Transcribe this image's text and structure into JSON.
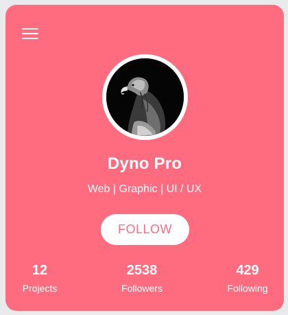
{
  "profile": {
    "name": "Dyno Pro",
    "subtitle": "Web | Graphic | UI / UX",
    "avatar_icon": "eagle-photo"
  },
  "menu": {
    "icon": "hamburger-menu-icon"
  },
  "actions": {
    "follow_label": "FOLLOW"
  },
  "stats": [
    {
      "value": "12",
      "label": "Projects"
    },
    {
      "value": "2538",
      "label": "Followers"
    },
    {
      "value": "429",
      "label": "Following"
    }
  ],
  "colors": {
    "card_background": "#ff6b7f",
    "page_background": "#e9eaec",
    "text": "#ffffff",
    "button_background": "#ffffff",
    "button_text": "#ff6b7f"
  }
}
